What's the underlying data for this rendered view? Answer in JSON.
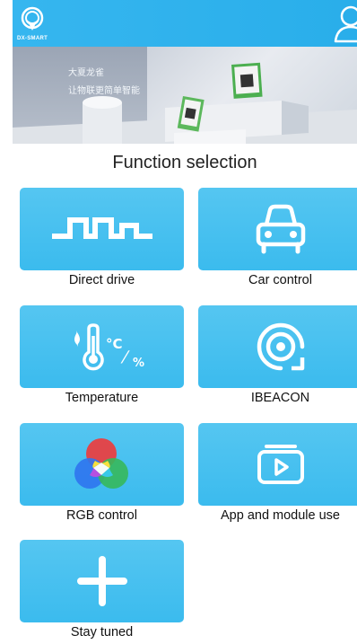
{
  "header": {
    "logo_text": "DX-SMART"
  },
  "banner": {
    "line1": "大夏龙雀",
    "line2": "让物联更简单智能"
  },
  "title": "Function selection",
  "functions": [
    {
      "label": "Direct drive",
      "icon": "square-wave-icon"
    },
    {
      "label": "Car control",
      "icon": "car-icon"
    },
    {
      "label": "Temperature",
      "icon": "thermometer-icon"
    },
    {
      "label": "IBEACON",
      "icon": "beacon-icon"
    },
    {
      "label": "RGB control",
      "icon": "rgb-circles-icon"
    },
    {
      "label": "App and module use",
      "icon": "video-play-icon"
    },
    {
      "label": "Stay tuned",
      "icon": "plus-icon"
    }
  ],
  "colors": {
    "header": "#29aeea",
    "tile": "#45c0f0",
    "text": "#111111"
  }
}
